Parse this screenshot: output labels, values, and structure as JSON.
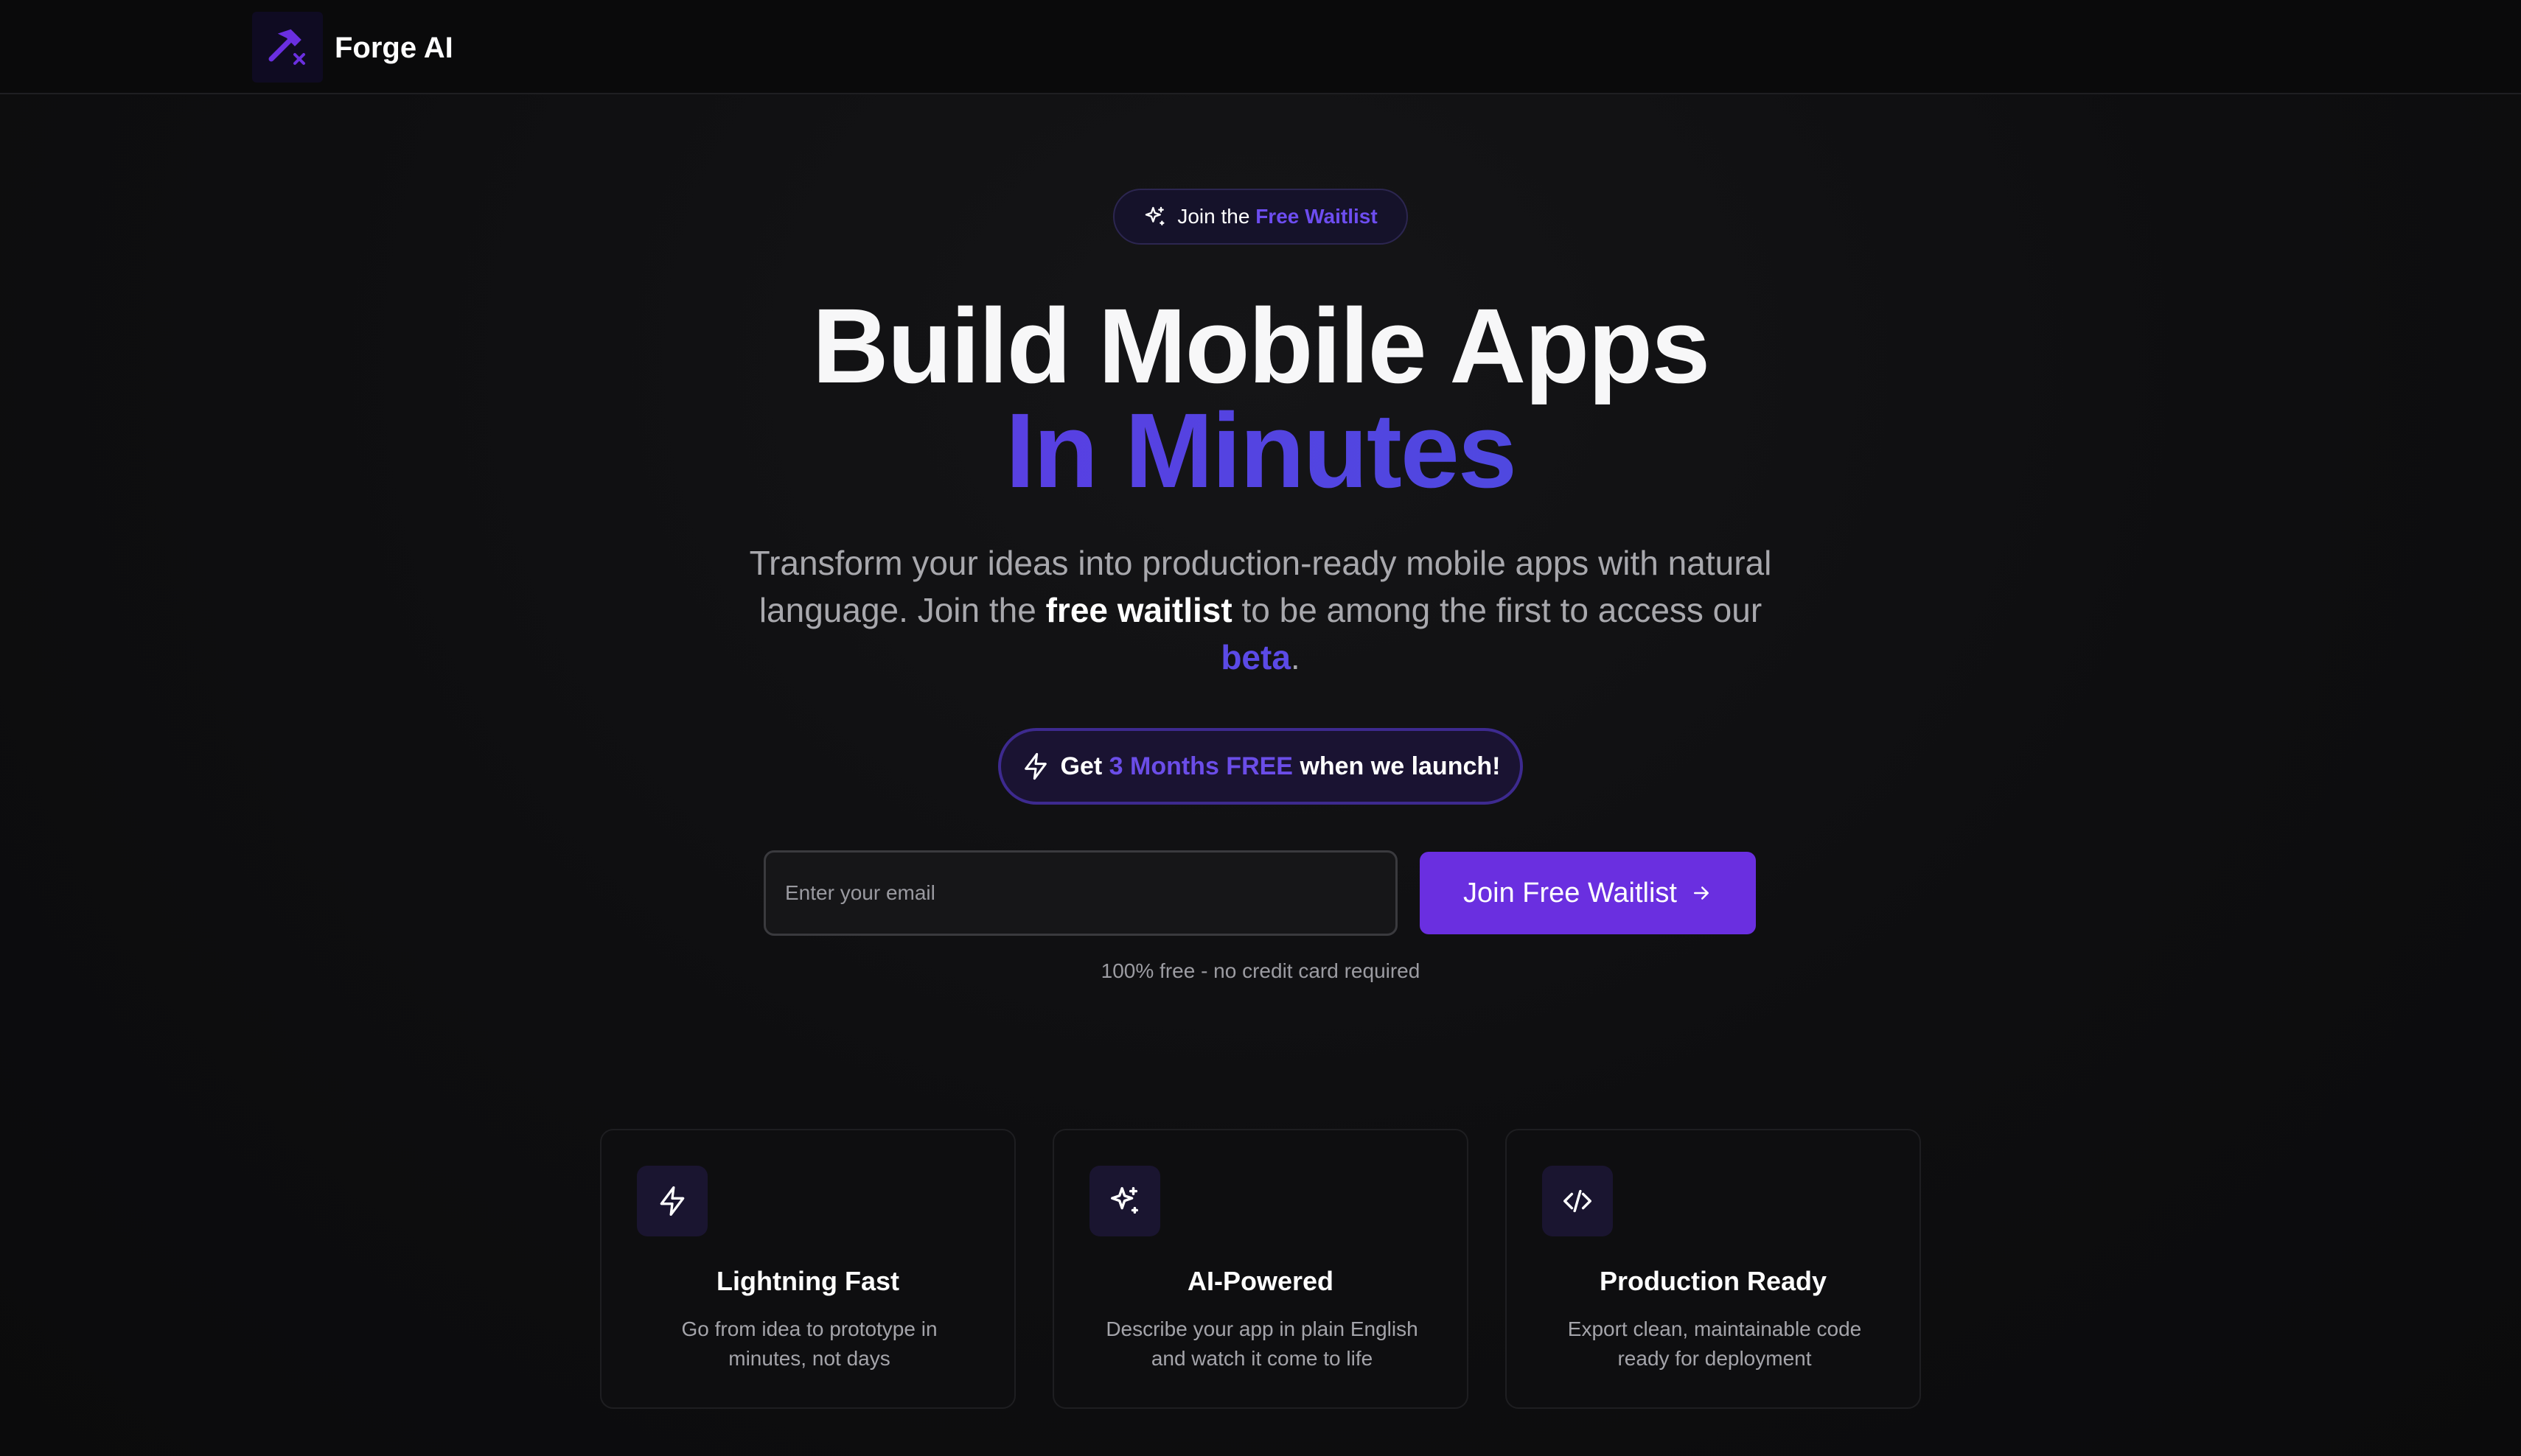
{
  "nav": {
    "brand": "Forge AI",
    "logo_icon": "hammer-x-icon"
  },
  "hero": {
    "badge": {
      "icon": "sparkles-icon",
      "prefix": "Join the",
      "highlight": "Free Waitlist"
    },
    "headline_line1": "Build Mobile Apps",
    "headline_line2": "In Minutes",
    "subtitle": {
      "part1": "Transform your ideas into production-ready mobile apps with natural language. Join the",
      "strong": "free waitlist",
      "part2": "to be among the first to access our",
      "accent": "beta",
      "end": "."
    },
    "promo": {
      "icon": "zap-icon",
      "prefix": "Get",
      "highlight": "3 Months FREE",
      "suffix": "when we launch!"
    }
  },
  "form": {
    "email_placeholder": "Enter your email",
    "email_value": "",
    "button_label": "Join Free Waitlist",
    "button_icon": "arrow-right-icon",
    "fine_print": "100% free - no credit card required"
  },
  "features": [
    {
      "icon": "zap-icon",
      "title": "Lightning Fast",
      "description": "Go from idea to prototype in minutes, not days"
    },
    {
      "icon": "sparkles-icon",
      "title": "AI-Powered",
      "description": "Describe your app in plain English and watch it come to life"
    },
    {
      "icon": "code-icon",
      "title": "Production Ready",
      "description": "Export clean, maintainable code ready for deployment"
    }
  ],
  "colors": {
    "accent": "#6a2fe0",
    "accent_text": "#5b4ae6",
    "background": "#0d0d0e"
  }
}
